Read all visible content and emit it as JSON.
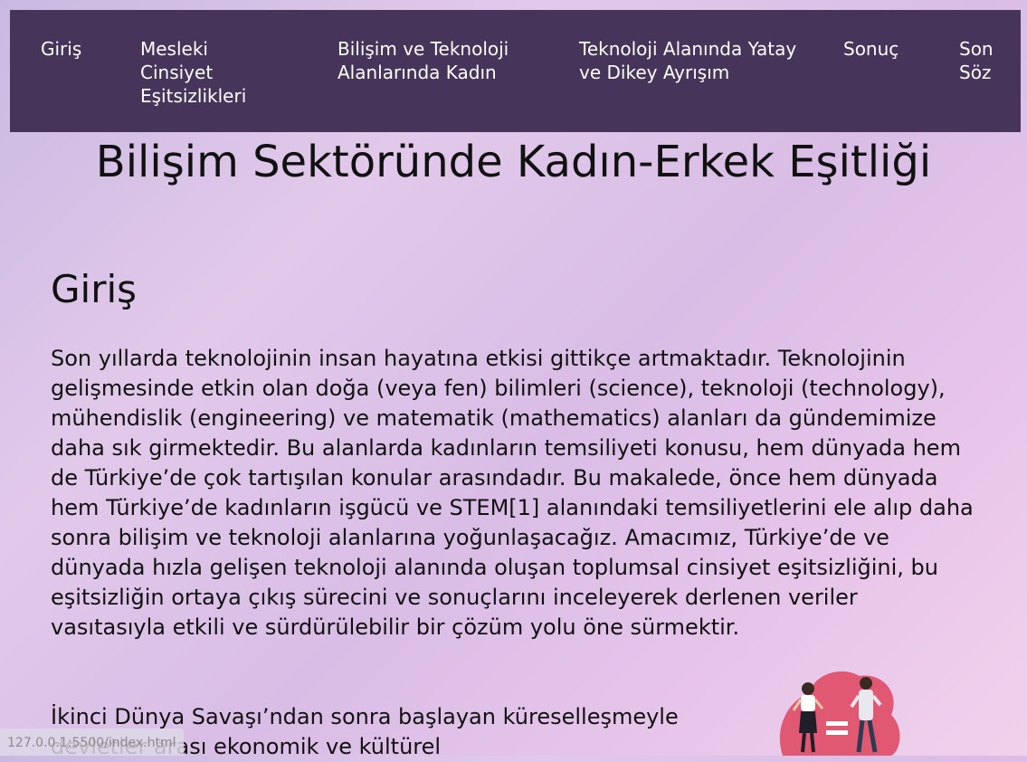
{
  "nav": {
    "items": [
      {
        "label": "Giriş"
      },
      {
        "label": "Mesleki Cinsiyet Eşitsizlikleri"
      },
      {
        "label": "Bilişim ve Teknoloji Alanlarında Kadın"
      },
      {
        "label": "Teknoloji Alanında Yatay ve Dikey Ayrışım"
      },
      {
        "label": "Sonuç"
      },
      {
        "label": "Son Söz"
      }
    ]
  },
  "page": {
    "title": "Bilişim Sektöründe Kadın-Erkek Eşitliği"
  },
  "intro": {
    "heading": "Giriş",
    "paragraph1": "Son yıllarda teknolojinin insan hayatına etkisi gittikçe artmaktadır. Teknolojinin gelişmesinde etkin olan doğa (veya fen) bilimleri (science), teknoloji (technology), mühendislik (engineering) ve matematik (mathematics) alanları da gündemimize daha sık girmektedir. Bu alanlarda kadınların temsiliyeti konusu, hem dünyada hem de Türkiye’de çok tartışılan konular arasındadır. Bu makalede, önce hem dünyada hem Türkiye’de kadınların işgücü ve STEM[1] alanındaki temsiliyetlerini ele alıp daha sonra bilişim ve teknoloji alanlarına yoğunlaşacağız. Amacımız, Türkiye’de ve dünyada hızla gelişen teknoloji alanında oluşan toplumsal cinsiyet eşitsizliğini, bu eşitsizliğin ortaya çıkış sürecini ve sonuçlarını inceleyerek derlenen veriler vasıtasıyla etkili ve sürdürülebilir bir çözüm yolu öne sürmektir.",
    "paragraph2": "İkinci Dünya Savaşı’ndan sonra başlayan küreselleşmeyle devletler arası ekonomik ve kültürel"
  },
  "illustration": {
    "icon": "gender-equality-illustration",
    "blob_color": "#e05872"
  },
  "status_bar": {
    "text": "127.0.0.1:5500/index.html"
  },
  "colors": {
    "navbar_bg": "#46345a",
    "nav_text": "#ffffff"
  }
}
